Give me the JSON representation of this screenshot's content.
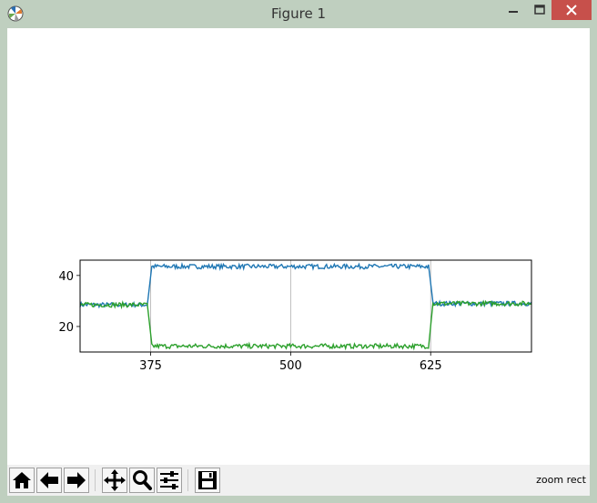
{
  "window": {
    "title": "Figure 1"
  },
  "toolbar": {
    "buttons": [
      {
        "name": "home",
        "icon": "home-icon"
      },
      {
        "name": "back",
        "icon": "arrow-left-icon"
      },
      {
        "name": "forward",
        "icon": "arrow-right-icon"
      },
      {
        "name": "pan",
        "icon": "move-icon"
      },
      {
        "name": "zoom",
        "icon": "magnifier-icon"
      },
      {
        "name": "configure",
        "icon": "sliders-icon"
      },
      {
        "name": "save",
        "icon": "floppy-icon"
      }
    ],
    "status": "zoom rect"
  },
  "chart_data": {
    "type": "line",
    "xlim": [
      312,
      715
    ],
    "ylim": [
      10,
      46
    ],
    "xticks": [
      375,
      500,
      625
    ],
    "yticks": [
      20,
      40
    ],
    "vlines": [
      375,
      500,
      625
    ],
    "grid": "x only",
    "series": [
      {
        "color": "#1f77b4",
        "segments": [
          {
            "x": [
              312,
              372
            ],
            "y": 28.5
          },
          {
            "x": [
              376,
              623
            ],
            "y": 43.5
          },
          {
            "x": [
              627,
              715
            ],
            "y": 29.0
          }
        ]
      },
      {
        "color": "#2ca02c",
        "segments": [
          {
            "x": [
              312,
              372
            ],
            "y": 28.5
          },
          {
            "x": [
              376,
              623
            ],
            "y": 12.3
          },
          {
            "x": [
              627,
              715
            ],
            "y": 29.0
          }
        ]
      }
    ]
  }
}
